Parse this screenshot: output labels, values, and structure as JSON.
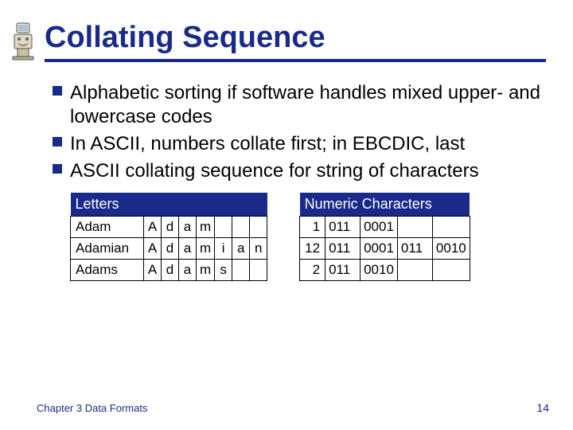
{
  "title": "Collating Sequence",
  "bullets": [
    "Alphabetic sorting if software handles mixed upper- and lowercase codes",
    "In ASCII, numbers collate first; in EBCDIC, last",
    "ASCII collating sequence for string of characters"
  ],
  "tables": {
    "letters": {
      "header": "Letters",
      "rows": [
        {
          "name": "Adam",
          "chars": [
            "A",
            "d",
            "a",
            "m",
            "",
            "",
            ""
          ]
        },
        {
          "name": "Adamian",
          "chars": [
            "A",
            "d",
            "a",
            "m",
            "i",
            "a",
            "n"
          ]
        },
        {
          "name": "Adams",
          "chars": [
            "A",
            "d",
            "a",
            "m",
            "s",
            "",
            ""
          ]
        }
      ]
    },
    "numeric": {
      "header": "Numeric Characters",
      "rows": [
        {
          "num": "1",
          "bits": [
            "011",
            "0001",
            "",
            ""
          ]
        },
        {
          "num": "12",
          "bits": [
            "011",
            "0001",
            "011",
            "0010"
          ]
        },
        {
          "num": "2",
          "bits": [
            "011",
            "0010",
            "",
            ""
          ]
        }
      ]
    }
  },
  "footer": "Chapter 3 Data Formats",
  "page": "14",
  "icon": "computer-clipart-icon"
}
